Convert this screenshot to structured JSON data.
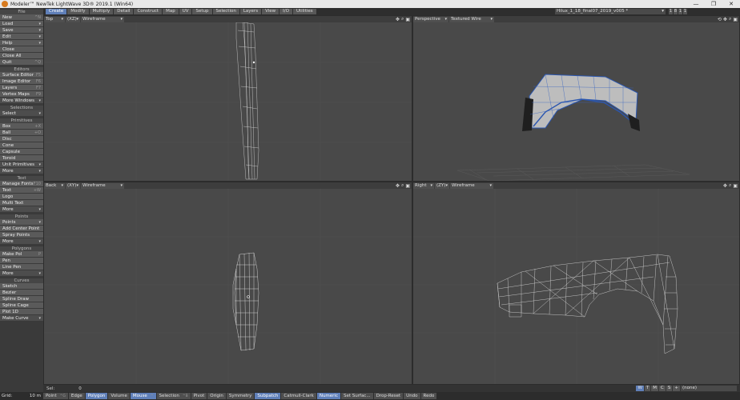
{
  "window": {
    "title": "Modeler™ NewTek LightWave 3D® 2019.1 (Win64)",
    "controls": [
      "—",
      "❐",
      "✕"
    ]
  },
  "tabs": [
    "Create",
    "Modify",
    "Multiply",
    "Detail",
    "Construct",
    "Map",
    "UV",
    "Setup",
    "Selection",
    "Layers",
    "View",
    "I/O",
    "Utilities"
  ],
  "object": {
    "name": "Hilux_1_18_final07_2019_v005 *",
    "layers": [
      "1",
      "8",
      "1",
      "1"
    ]
  },
  "sidebar": {
    "file": {
      "header": "File",
      "items": [
        {
          "label": "New",
          "sc": "^N",
          "arrow": true
        },
        {
          "label": "Load",
          "sc": "",
          "arrow": true
        },
        {
          "label": "Save",
          "sc": "",
          "arrow": true
        },
        {
          "label": "Edit",
          "sc": "",
          "arrow": true
        },
        {
          "label": "Help",
          "sc": "",
          "arrow": true
        },
        {
          "label": "Close",
          "sc": ""
        },
        {
          "label": "Close All",
          "sc": ""
        },
        {
          "label": "Quit",
          "sc": "^Q"
        }
      ]
    },
    "editors": {
      "header": "Editors",
      "items": [
        {
          "label": "Surface Editor",
          "sc": "F5"
        },
        {
          "label": "Image Editor",
          "sc": "F6"
        },
        {
          "label": "Layers",
          "sc": "F7"
        },
        {
          "label": "Vertex Maps",
          "sc": "F9"
        },
        {
          "label": "More Windows",
          "drop": true
        }
      ]
    },
    "selections": {
      "header": "Selections",
      "items": [
        {
          "label": "Select",
          "drop": true
        }
      ]
    },
    "primitives": {
      "header": "Primitives",
      "items": [
        {
          "label": "Box",
          "sc": "+X"
        },
        {
          "label": "Ball",
          "sc": "+O"
        },
        {
          "label": "Disc",
          "sc": ""
        },
        {
          "label": "Cone",
          "sc": ""
        },
        {
          "label": "Capsule",
          "sc": ""
        },
        {
          "label": "Toroid",
          "sc": ""
        },
        {
          "label": "Unit Primitives",
          "drop": true
        },
        {
          "label": "More",
          "drop": true
        }
      ]
    },
    "text": {
      "header": "Text",
      "items": [
        {
          "label": "Manage Fonts",
          "sc": "F10"
        },
        {
          "label": "Text",
          "sc": "+W"
        },
        {
          "label": "Logo",
          "sc": ""
        },
        {
          "label": "Multi Text",
          "sc": ""
        },
        {
          "label": "More",
          "drop": true
        }
      ]
    },
    "points": {
      "header": "Points",
      "items": [
        {
          "label": "Points",
          "sc": "",
          "arrow": true
        },
        {
          "label": "Add Center Point",
          "sc": ""
        },
        {
          "label": "Spray Points",
          "sc": ""
        },
        {
          "label": "More",
          "drop": true
        }
      ]
    },
    "polygons": {
      "header": "Polygons",
      "items": [
        {
          "label": "Make Pol",
          "sc": "P"
        },
        {
          "label": "Pen",
          "sc": ""
        },
        {
          "label": "Line Pen",
          "sc": ""
        },
        {
          "label": "More",
          "drop": true
        }
      ]
    },
    "curves": {
      "header": "Curves",
      "items": [
        {
          "label": "Sketch",
          "sc": ""
        },
        {
          "label": "Bezier",
          "sc": ""
        },
        {
          "label": "Spline Draw",
          "sc": ""
        },
        {
          "label": "Spline Cage",
          "sc": ""
        },
        {
          "label": "Plot 1D",
          "sc": ""
        },
        {
          "label": "Make Curve",
          "drop": true
        }
      ]
    }
  },
  "viewports": {
    "top": {
      "view": "Top",
      "axis": "(XZ)",
      "mode": "Wireframe"
    },
    "perspective": {
      "view": "Perspective",
      "mode": "Textured Wire"
    },
    "back": {
      "view": "Back",
      "axis": "(XY)",
      "mode": "Wireframe"
    },
    "right": {
      "view": "Right",
      "axis": "(ZY)",
      "mode": "Wireframe"
    }
  },
  "status": {
    "label": "Sel:",
    "value": "0",
    "toggles": [
      "W",
      "T",
      "M",
      "C",
      "S",
      "+"
    ],
    "surface": "(none)"
  },
  "bottom": {
    "grid_label": "Grid:",
    "grid_value": "10 m",
    "buttons": [
      {
        "label": "Point",
        "key": "^G",
        "on": false
      },
      {
        "label": "Edge",
        "key": "",
        "on": false
      },
      {
        "label": "Polygon",
        "key": "",
        "on": true
      },
      {
        "label": "Volume",
        "key": "",
        "on": false
      },
      {
        "label": "Mouse",
        "key": "^",
        "on": true
      },
      {
        "label": "Selection",
        "key": "^B",
        "on": false
      },
      {
        "label": "Pivot",
        "key": "",
        "on": false
      },
      {
        "label": "Origin",
        "key": "",
        "on": false
      },
      {
        "label": "Symmetry",
        "key": "",
        "on": false
      },
      {
        "label": "Subpatch",
        "key": "",
        "on": true
      },
      {
        "label": "Catmull-Clark",
        "key": "",
        "on": false
      },
      {
        "label": "Numeric",
        "key": "",
        "on": true
      },
      {
        "label": "Set Surfac...",
        "key": "",
        "on": false
      },
      {
        "label": "Drop-Reset",
        "key": "",
        "on": false
      },
      {
        "label": "Undo",
        "key": "",
        "on": false
      },
      {
        "label": "Redo",
        "key": "",
        "on": false
      }
    ]
  }
}
